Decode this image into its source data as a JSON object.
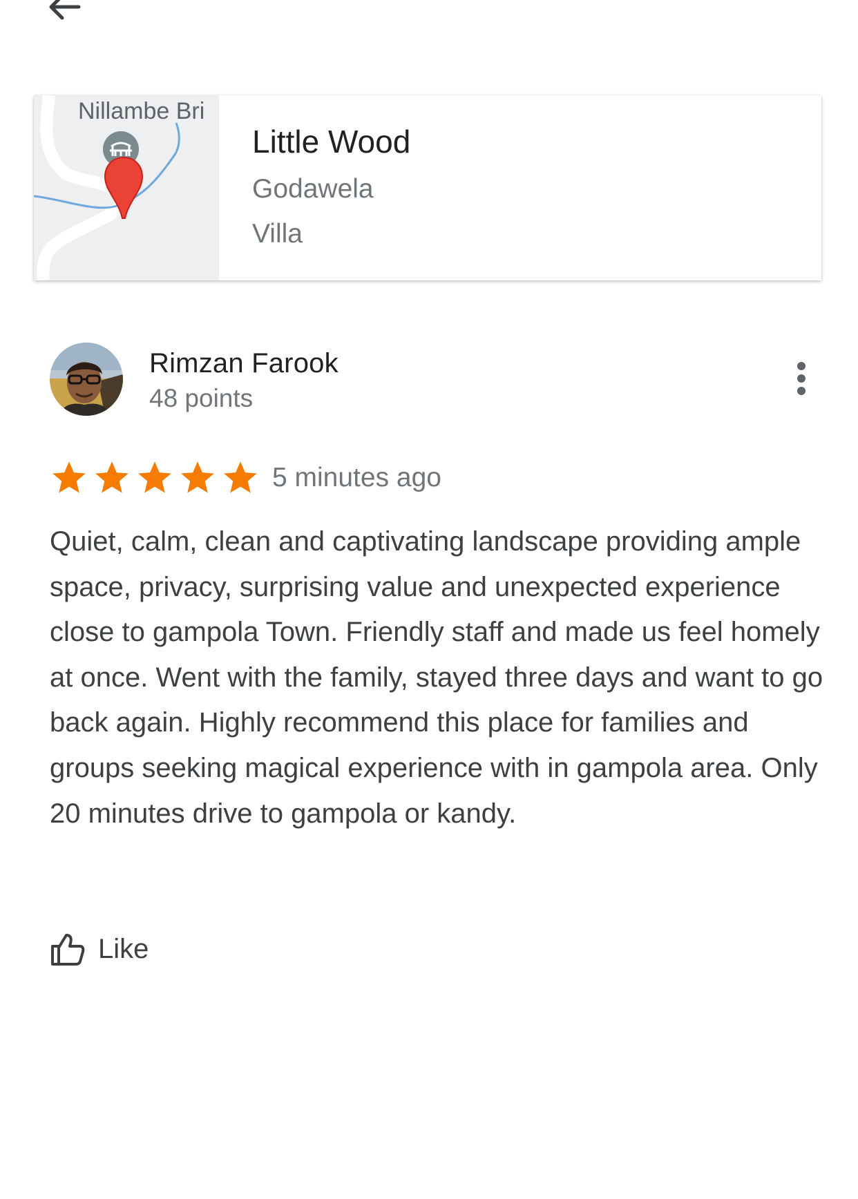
{
  "header": {
    "back_icon": "arrow-back-icon"
  },
  "place": {
    "map_label": "Nillambe Bri",
    "name": "Little Wood",
    "area": "Godawela",
    "type": "Villa"
  },
  "reviewer": {
    "name": "Rimzan Farook",
    "points": "48 points"
  },
  "review": {
    "rating": 5,
    "max_rating": 5,
    "time_ago": "5 minutes ago",
    "text": "Quiet, calm, clean and captivating landscape providing ample space, privacy, surprising value and unexpected experience close to gampola Town. Friendly staff and made us feel homely at once. Went with the family, stayed three days and want to go back again. Highly recommend this place for families and groups seeking magical experience with in gampola area. Only 20 minutes drive to gampola or kandy."
  },
  "actions": {
    "like_label": "Like",
    "like_icon": "thumb-up-icon",
    "more_icon": "more-vert-icon"
  },
  "colors": {
    "star": "#f57c00",
    "pin": "#ea4335",
    "river": "#6fa8dc"
  }
}
